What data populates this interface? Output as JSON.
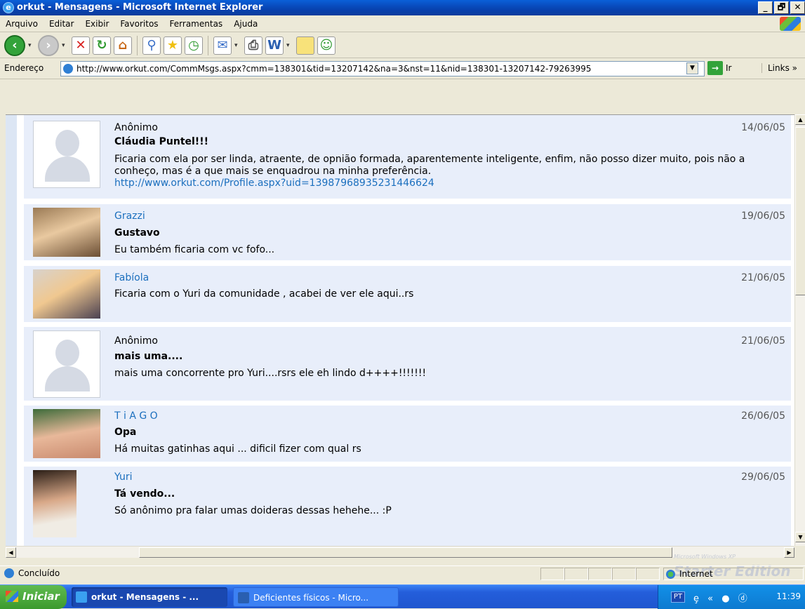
{
  "window": {
    "title": "orkut - Mensagens - Microsoft Internet Explorer",
    "buttons": [
      "_",
      "🗗",
      "✕"
    ]
  },
  "menu": [
    "Arquivo",
    "Editar",
    "Exibir",
    "Favoritos",
    "Ferramentas",
    "Ajuda"
  ],
  "toolbar": {
    "icons": [
      "back-icon",
      "forward-icon",
      "stop-icon",
      "refresh-icon",
      "home-icon",
      "search-icon",
      "favorites-icon",
      "history-icon",
      "mail-icon",
      "print-icon",
      "edit-icon",
      "discuss-icon",
      "messenger-icon"
    ]
  },
  "address": {
    "label": "Endereço",
    "url": "http://www.orkut.com/CommMsgs.aspx?cmm=138301&tid=13207142&na=3&nst=11&nid=138301-13207142-79263995",
    "go_label": "Ir",
    "links_label": "Links"
  },
  "posts": [
    {
      "author": "Anônimo",
      "date": "14/06/05",
      "subject": "Cláudia Puntel!!!",
      "body": "Ficaria com ela por ser linda, atraente, de opnião formada, aparentemente inteligente, enfim, não posso dizer muito, pois não a conheço, mas é a que mais se enquadrou na minha preferência.",
      "link": "http://www.orkut.com/Profile.aspx?uid=13987968935231446624"
    },
    {
      "author": "Grazzi",
      "date": "19/06/05",
      "subject": "Gustavo",
      "body": "Eu também ficaria com vc fofo..."
    },
    {
      "author": "Fabíola",
      "date": "21/06/05",
      "subject": "",
      "body": "Ficaria com o Yuri da comunidade , acabei de ver ele aqui..rs"
    },
    {
      "author": "Anônimo",
      "date": "21/06/05",
      "subject": "mais uma....",
      "body": "mais uma concorrente pro Yuri....rsrs ele eh lindo d++++!!!!!!!"
    },
    {
      "author": "T i A G O",
      "date": "26/06/05",
      "subject": "Opa",
      "body": "Há muitas gatinhas aqui ... dificil fizer com qual rs"
    },
    {
      "author": "Yuri",
      "date": "29/06/05",
      "subject": "Tá vendo...",
      "body": "Só anônimo pra falar umas doideras dessas hehehe... :P"
    }
  ],
  "watermark": {
    "small": "Microsoft Windows XP",
    "big": "Starter Edition"
  },
  "status": {
    "text": "Concluído",
    "zone": "Internet"
  },
  "taskbar": {
    "start": "Iniciar",
    "tasks": [
      "orkut - Mensagens - ...",
      "Deficientes físicos - Micro..."
    ],
    "lang": "PT",
    "tray_icons": "ȩ « ● ⓓ",
    "clock": "11:39"
  }
}
